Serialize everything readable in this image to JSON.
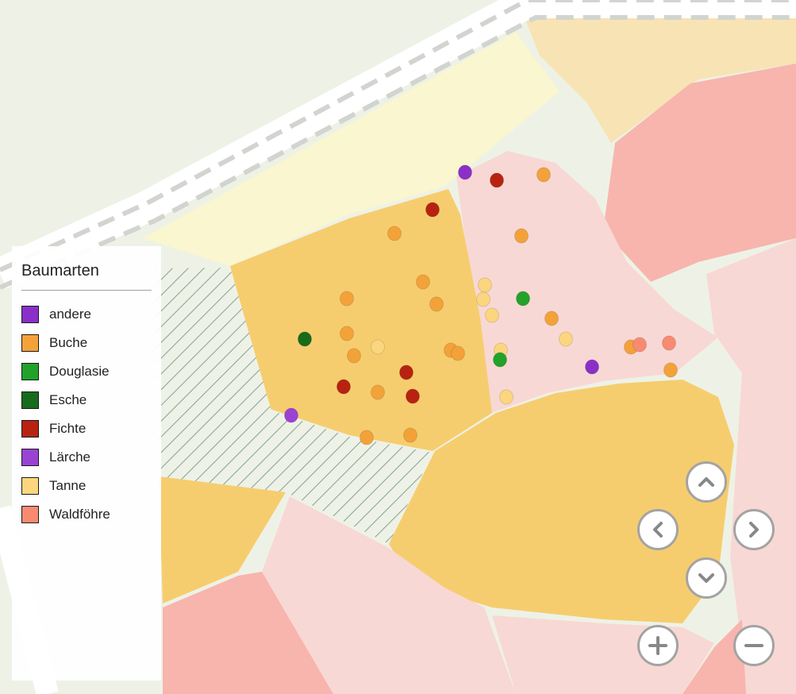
{
  "legend": {
    "title": "Baumarten",
    "items": [
      {
        "key": "andere",
        "label": "andere",
        "color": "#8b2fc9"
      },
      {
        "key": "buche",
        "label": "Buche",
        "color": "#f3a23a"
      },
      {
        "key": "douglasie",
        "label": "Douglasie",
        "color": "#22a22a"
      },
      {
        "key": "esche",
        "label": "Esche",
        "color": "#176b1b"
      },
      {
        "key": "fichte",
        "label": "Fichte",
        "color": "#b82211"
      },
      {
        "key": "laerche",
        "label": "Lärche",
        "color": "#9a42d4"
      },
      {
        "key": "tanne",
        "label": "Tanne",
        "color": "#fbd67e"
      },
      {
        "key": "waldfoehre",
        "label": "Waldföhre",
        "color": "#f98a72"
      }
    ]
  },
  "map_colors": {
    "background": "#eef2e6",
    "road": "#ffffff",
    "road_dash": "#d2d4d0",
    "stand_orange": "#f6cd6e",
    "stand_pink_light": "#f8d8d4",
    "stand_pink": "#f7b5ad",
    "stand_cream": "#f9f6d0",
    "stand_peach": "#f8e3b4",
    "hatch_line": "#8da59a"
  },
  "controls": {
    "pan_up": {
      "icon": "chevron-up-icon"
    },
    "pan_left": {
      "icon": "chevron-left-icon"
    },
    "pan_right": {
      "icon": "chevron-right-icon"
    },
    "pan_down": {
      "icon": "chevron-down-icon"
    },
    "zoom_in": {
      "icon": "plus-icon"
    },
    "zoom_out": {
      "icon": "minus-icon"
    }
  }
}
